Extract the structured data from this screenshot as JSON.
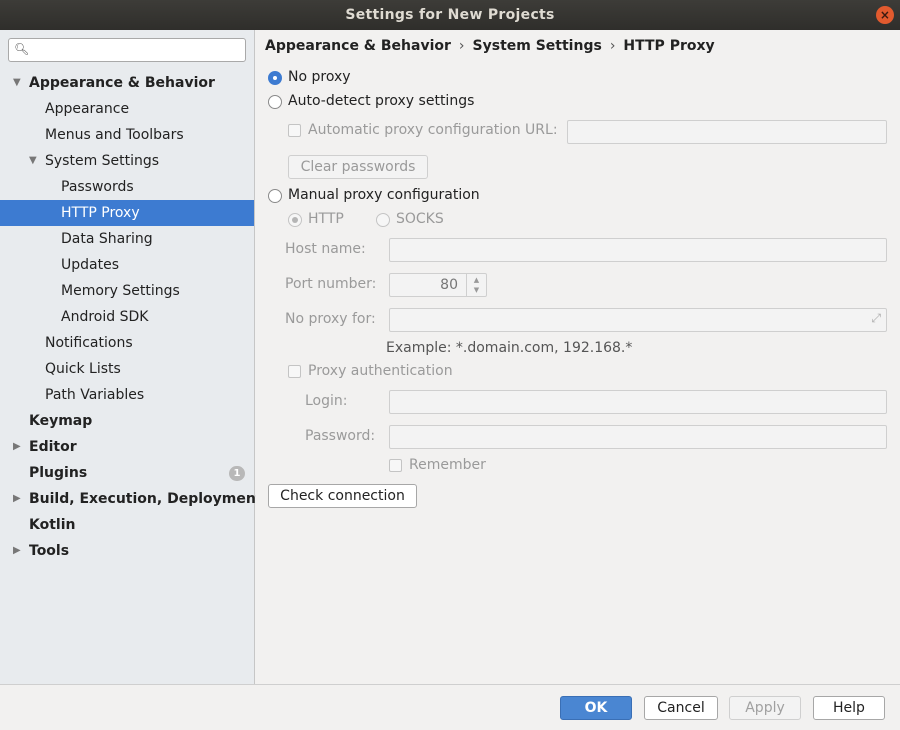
{
  "window": {
    "title": "Settings for New Projects",
    "close_glyph": "×"
  },
  "search": {
    "placeholder": "",
    "value": ""
  },
  "tree": [
    {
      "label": "Appearance & Behavior",
      "bold": true,
      "arrow": "expanded"
    },
    {
      "label": "Appearance"
    },
    {
      "label": "Menus and Toolbars"
    },
    {
      "label": "System Settings",
      "arrow": "expanded"
    },
    {
      "label": "Passwords"
    },
    {
      "label": "HTTP Proxy",
      "selected": true
    },
    {
      "label": "Data Sharing"
    },
    {
      "label": "Updates"
    },
    {
      "label": "Memory Settings"
    },
    {
      "label": "Android SDK"
    },
    {
      "label": "Notifications"
    },
    {
      "label": "Quick Lists"
    },
    {
      "label": "Path Variables"
    },
    {
      "label": "Keymap",
      "bold": true
    },
    {
      "label": "Editor",
      "bold": true,
      "arrow": "collapsed"
    },
    {
      "label": "Plugins",
      "bold": true,
      "badge": "1"
    },
    {
      "label": "Build, Execution, Deployment",
      "bold": true,
      "arrow": "collapsed"
    },
    {
      "label": "Kotlin",
      "bold": true
    },
    {
      "label": "Tools",
      "bold": true,
      "arrow": "collapsed"
    }
  ],
  "breadcrumb": {
    "part1": "Appearance & Behavior",
    "part2": "System Settings",
    "part3": "HTTP Proxy",
    "sep": "›"
  },
  "proxy": {
    "no_proxy": "No proxy",
    "auto_detect": "Auto-detect proxy settings",
    "auto_config_url": "Automatic proxy configuration URL:",
    "clear_passwords": "Clear passwords",
    "manual": "Manual proxy configuration",
    "http": "HTTP",
    "socks": "SOCKS",
    "host_name": "Host name:",
    "port_number": "Port number:",
    "port_value": "80",
    "no_proxy_for": "No proxy for:",
    "example": "Example: *.domain.com, 192.168.*",
    "proxy_auth": "Proxy authentication",
    "login": "Login:",
    "password": "Password:",
    "remember": "Remember",
    "check_connection": "Check connection"
  },
  "footer": {
    "ok": "OK",
    "cancel": "Cancel",
    "apply": "Apply",
    "help": "Help"
  },
  "colors": {
    "selection": "#3d7bd1",
    "titlebar": "#2f2e2b",
    "close": "#e25a2e"
  }
}
